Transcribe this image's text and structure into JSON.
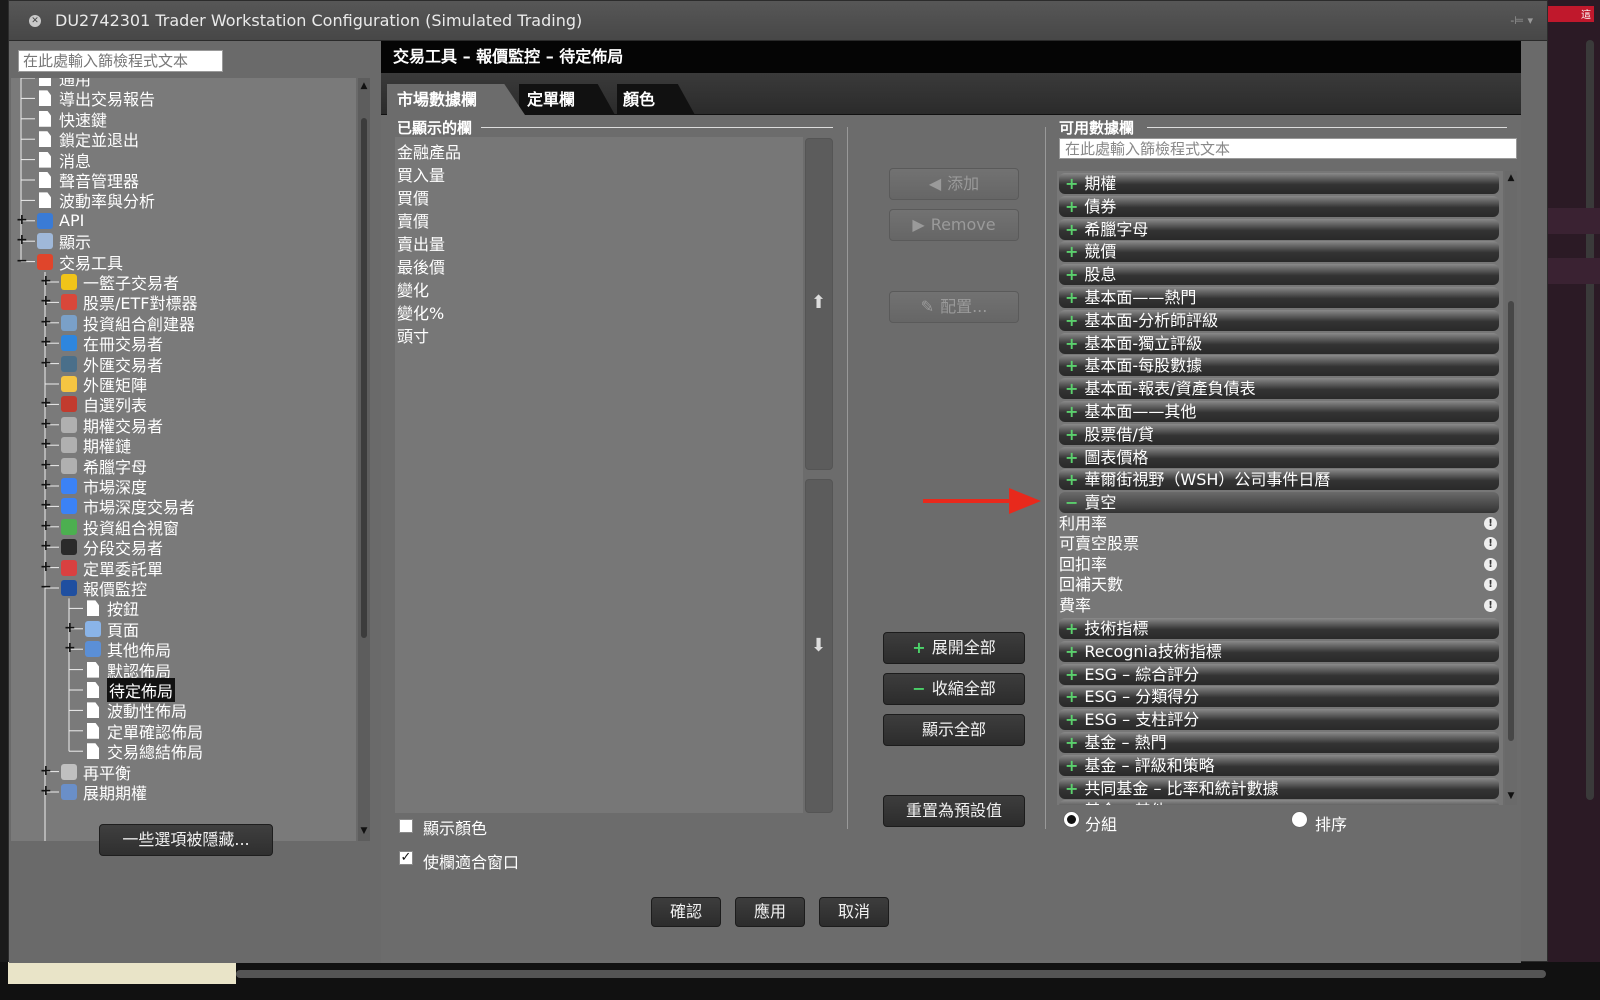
{
  "window": {
    "title": "DU2742301 Trader Workstation Configuration (Simulated Trading)",
    "controls": "-⊨ ▾"
  },
  "background": {
    "badge": "這"
  },
  "left": {
    "filter_placeholder": "在此處輸入篩檢程式文本",
    "tree": [
      {
        "label": "通用",
        "icon": "doc"
      },
      {
        "label": "導出交易報告",
        "icon": "doc"
      },
      {
        "label": "快速鍵",
        "icon": "doc"
      },
      {
        "label": "鎖定並退出",
        "icon": "doc"
      },
      {
        "label": "消息",
        "icon": "doc"
      },
      {
        "label": "聲音管理器",
        "icon": "doc"
      },
      {
        "label": "波動率與分析",
        "icon": "doc"
      },
      {
        "label": "API",
        "icon": "api"
      },
      {
        "label": "顯示",
        "icon": "display"
      },
      {
        "label": "交易工具",
        "icon": "tools"
      },
      {
        "label": "一籃子交易者",
        "icon": "basket"
      },
      {
        "label": "股票/ETF對標器",
        "icon": "chart"
      },
      {
        "label": "投資組合創建器",
        "icon": "portfolio"
      },
      {
        "label": "在冊交易者",
        "icon": "book"
      },
      {
        "label": "外匯交易者",
        "icon": "fx"
      },
      {
        "label": "外匯矩陣",
        "icon": "fxmatrix"
      },
      {
        "label": "自選列表",
        "icon": "watchlist"
      },
      {
        "label": "期權交易者",
        "icon": "option"
      },
      {
        "label": "期權鏈",
        "icon": "option"
      },
      {
        "label": "希臘字母",
        "icon": "option"
      },
      {
        "label": "市場深度",
        "icon": "depth"
      },
      {
        "label": "市場深度交易者",
        "icon": "depth"
      },
      {
        "label": "投資組合視窗",
        "icon": "portfolio2"
      },
      {
        "label": "分段交易者",
        "icon": "split"
      },
      {
        "label": "定單委託單",
        "icon": "order"
      },
      {
        "label": "報價監控",
        "icon": "ib"
      },
      {
        "label": "按鈕",
        "icon": "doc"
      },
      {
        "label": "頁面",
        "icon": "page"
      },
      {
        "label": "其他佈局",
        "icon": "layout"
      },
      {
        "label": "默認佈局",
        "icon": "doc"
      },
      {
        "label": "待定佈局",
        "icon": "doc"
      },
      {
        "label": "波動性佈局",
        "icon": "doc"
      },
      {
        "label": "定單確認佈局",
        "icon": "doc"
      },
      {
        "label": "交易總結佈局",
        "icon": "doc"
      },
      {
        "label": "再平衡",
        "icon": "rebalance"
      },
      {
        "label": "展期期權",
        "icon": "rollover"
      }
    ],
    "hidden_button": "一些選項被隱藏..."
  },
  "content": {
    "header": "交易工具 – 報價監控 – 待定佈局",
    "tabs": [
      {
        "label": "市場數據欄"
      },
      {
        "label": "定單欄"
      },
      {
        "label": "顏色"
      }
    ],
    "displayed": {
      "title": "已顯示的欄",
      "items": [
        "金融產品",
        "買入量",
        "買價",
        "賣價",
        "賣出量",
        "最後價",
        "變化",
        "變化%",
        "頭寸"
      ]
    },
    "arrows": {
      "up": "⬆",
      "down": "⬇"
    },
    "buttons": {
      "add": "添加",
      "remove": "Remove",
      "configure": "配置...",
      "expand_all": "展開全部",
      "collapse_all": "收縮全部",
      "show_all": "顯示全部",
      "reset": "重置為預設值"
    },
    "checkboxes": {
      "show_color": "顯示顏色",
      "fit_window": "使欄適合窗口",
      "checked_mark": "✓"
    },
    "available": {
      "title": "可用數據欄",
      "filter_placeholder": "在此處輸入篩檢程式文本",
      "categories_before": [
        "期權",
        "債券",
        "希臘字母",
        "競價",
        "股息",
        "基本面——熱門",
        "基本面-分析師評級",
        "基本面-獨立評級",
        "基本面-每股數據",
        "基本面-報表/資產負債表",
        "基本面——其他",
        "股票借/貸",
        "圖表價格",
        "華爾街視野（WSH）公司事件日曆"
      ],
      "open_category": "賣空",
      "sub_items": [
        "利用率",
        "可賣空股票",
        "回扣率",
        "回補天數",
        "費率"
      ],
      "categories_after": [
        "技術指標",
        "Recognia技術指標",
        "ESG – 綜合評分",
        "ESG – 分類得分",
        "ESG – 支柱評分",
        "基金 – 熱門",
        "基金 – 評級和策略",
        "共同基金 – 比率和統計數據",
        "基金 – 其他"
      ]
    },
    "radios": {
      "group": "分組",
      "sort": "排序",
      "selected": "group"
    },
    "footer": {
      "ok": "確認",
      "apply": "應用",
      "cancel": "取消"
    }
  }
}
